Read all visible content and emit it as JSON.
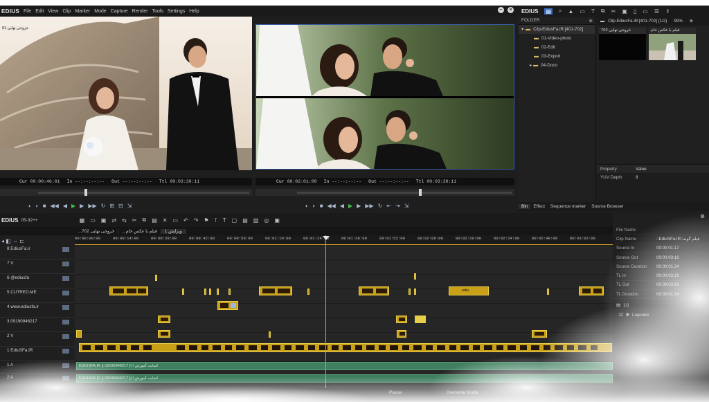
{
  "app": {
    "name": "EDIUS",
    "menu": [
      "File",
      "Edit",
      "View",
      "Clip",
      "Marker",
      "Mode",
      "Capture",
      "Render",
      "Tools",
      "Settings",
      "Help"
    ]
  },
  "player": {
    "overlay_text": "خروجی نهایی 01",
    "cur_label": "Cur",
    "cur": "00:00:46:01",
    "in_label": "In",
    "in": "--:--:--:--",
    "out_label": "Out",
    "out": "--:--:--:--",
    "ttl_label": "Ttl",
    "ttl": "00:03:30:11"
  },
  "recorder": {
    "cur_label": "Cur",
    "cur": "00:02:01:00",
    "in_label": "In",
    "in": "--:--:--:--",
    "out_label": "Out",
    "out": "--:--:--:--",
    "ttl_label": "Ttl",
    "ttl": "00:03:30:11"
  },
  "bin": {
    "folder_title": "FOLDER",
    "root": "Clip-EdiusFa.iR:[401-702]",
    "folders": [
      "01-Video-photo",
      "02-Edit",
      "03-Export",
      "04-Doco"
    ],
    "clip_tab": "Clip-EdiusFa.iR:[401-702] (1/2)",
    "zoom": "99%",
    "thumbnails": [
      {
        "label": "خروجی نهایی 702"
      },
      {
        "label": "فیلم با عکس خام"
      }
    ],
    "property_header": "Property",
    "value_header": "Value",
    "properties": [
      {
        "k": "YUV Depth",
        "v": "8"
      }
    ],
    "tabs": [
      "Bin",
      "Effect",
      "Sequence marker",
      "Source Browser"
    ]
  },
  "timeline": {
    "version": "05-32++",
    "sequence_tabs": [
      "...خروجی نهایی 702",
      "...فیلم با عکس خام",
      "ویرایش 1"
    ],
    "ruler": [
      "00:00:00:00",
      "00:00:14:00",
      "00:00:28:00",
      "00:00:42:00",
      "00:00:56:00",
      "00:01:10:00",
      "00:01:24:00",
      "00:01:38:00",
      "00:01:52:00",
      "00:02:06:00",
      "00:02:20:00",
      "00:02:34:00",
      "00:02:48:00",
      "00:03:02:00"
    ],
    "tracks": [
      {
        "name": "8 EdiusFa.ir"
      },
      {
        "name": "7 V"
      },
      {
        "name": "6 @ediusfa"
      },
      {
        "name": "5 CUTRED.ME"
      },
      {
        "name": "4 www.ediusfa.ir"
      },
      {
        "name": "3 09190946217"
      },
      {
        "name": "2 V"
      },
      {
        "name": "1 EdiuSFa.IR"
      },
      {
        "name": "1 A"
      },
      {
        "name": "2 A"
      }
    ],
    "audio_clips": [
      "EDIUSFA.IR || 09190946217 || اسایت آموزش ا",
      "EDIUSFA.IR || 09190946217 || اسایت آموزش ا"
    ],
    "clip_label": "ediu"
  },
  "info": {
    "rows": [
      {
        "k": "File Name",
        "v": ""
      },
      {
        "k": "Clip Name",
        "v": "::EdiuSFa.IR::فیلم گونه"
      },
      {
        "k": "Source In",
        "v": "00:00:01:17"
      },
      {
        "k": "Source Out",
        "v": "00:00:03:16"
      },
      {
        "k": "Source Duration",
        "v": "00:00:01:24"
      },
      {
        "k": "TL In",
        "v": "00:00:03:16"
      },
      {
        "k": "TL Out",
        "v": "00:00:03:16"
      },
      {
        "k": "TL Duration",
        "v": "00:00:01:24"
      }
    ],
    "page": "1/1",
    "layouter": "Layouter"
  },
  "status": {
    "state": "Pause",
    "mode": "Overwrite Mode"
  }
}
